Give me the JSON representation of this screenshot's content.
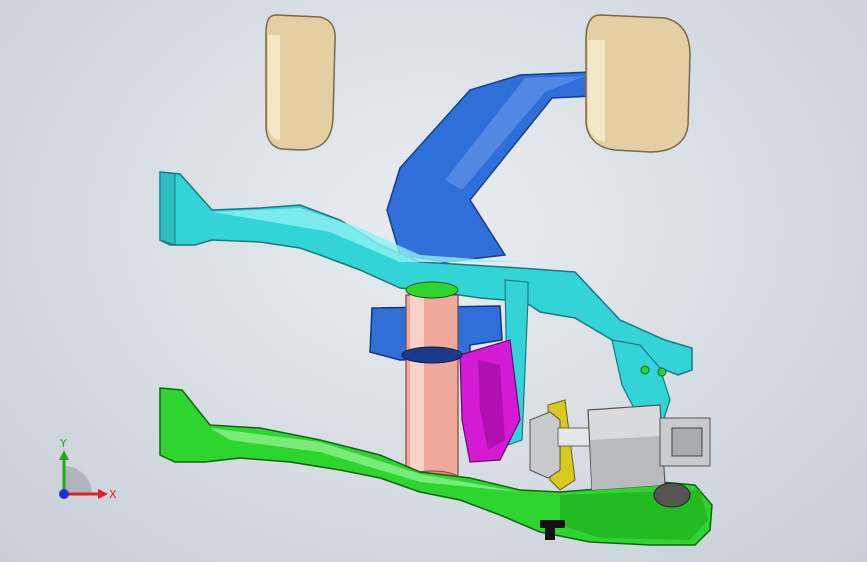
{
  "viewport": {
    "background_color": "#d9dee4"
  },
  "triad": {
    "x_label": "X",
    "y_label": "Y",
    "x_color": "#e11f1f",
    "y_color": "#22a822",
    "z_color": "#2233cc"
  },
  "parts": {
    "pedal_pads": "#e4cfa2",
    "upper_arm": "#33d4d8",
    "lower_arm": "#2ed52e",
    "bracket": "#2f6fd9",
    "pivot_tube": "#f0a89a",
    "spring_bracket": "#d51ad5",
    "sensor": "#d8dadc",
    "yellow_plate": "#d8c81f"
  }
}
